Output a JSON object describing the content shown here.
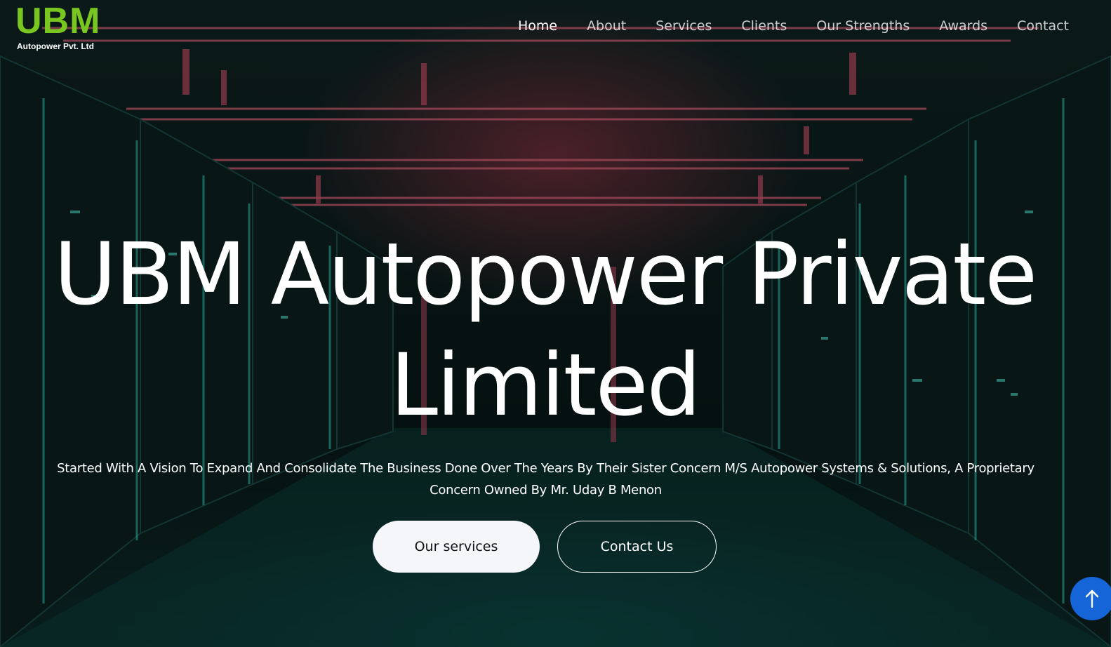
{
  "brand": {
    "name": "UBM",
    "tagline": "Autopower Pvt. Ltd",
    "accent_color": "#7ac620"
  },
  "nav": {
    "items": [
      {
        "label": "Home",
        "active": true
      },
      {
        "label": "About",
        "active": false
      },
      {
        "label": "Services",
        "active": false
      },
      {
        "label": "Clients",
        "active": false
      },
      {
        "label": "Our Strengths",
        "active": false
      },
      {
        "label": "Awards",
        "active": false
      },
      {
        "label": "Contact",
        "active": false
      }
    ]
  },
  "hero": {
    "title_line1": "UBM Autopower Private",
    "title_line2": "Limited",
    "description_line1": "Started With A Vision To Expand And Consolidate The Business Done Over The Years By Their Sister Concern M/S Autopower Systems & Solutions, A Proprietary",
    "description_line2": "Concern Owned By Mr. Uday B Menon",
    "primary_button": "Our services",
    "secondary_button": "Contact Us"
  },
  "scroll_top": {
    "icon": "arrow-up-icon",
    "color": "#1565d8"
  }
}
